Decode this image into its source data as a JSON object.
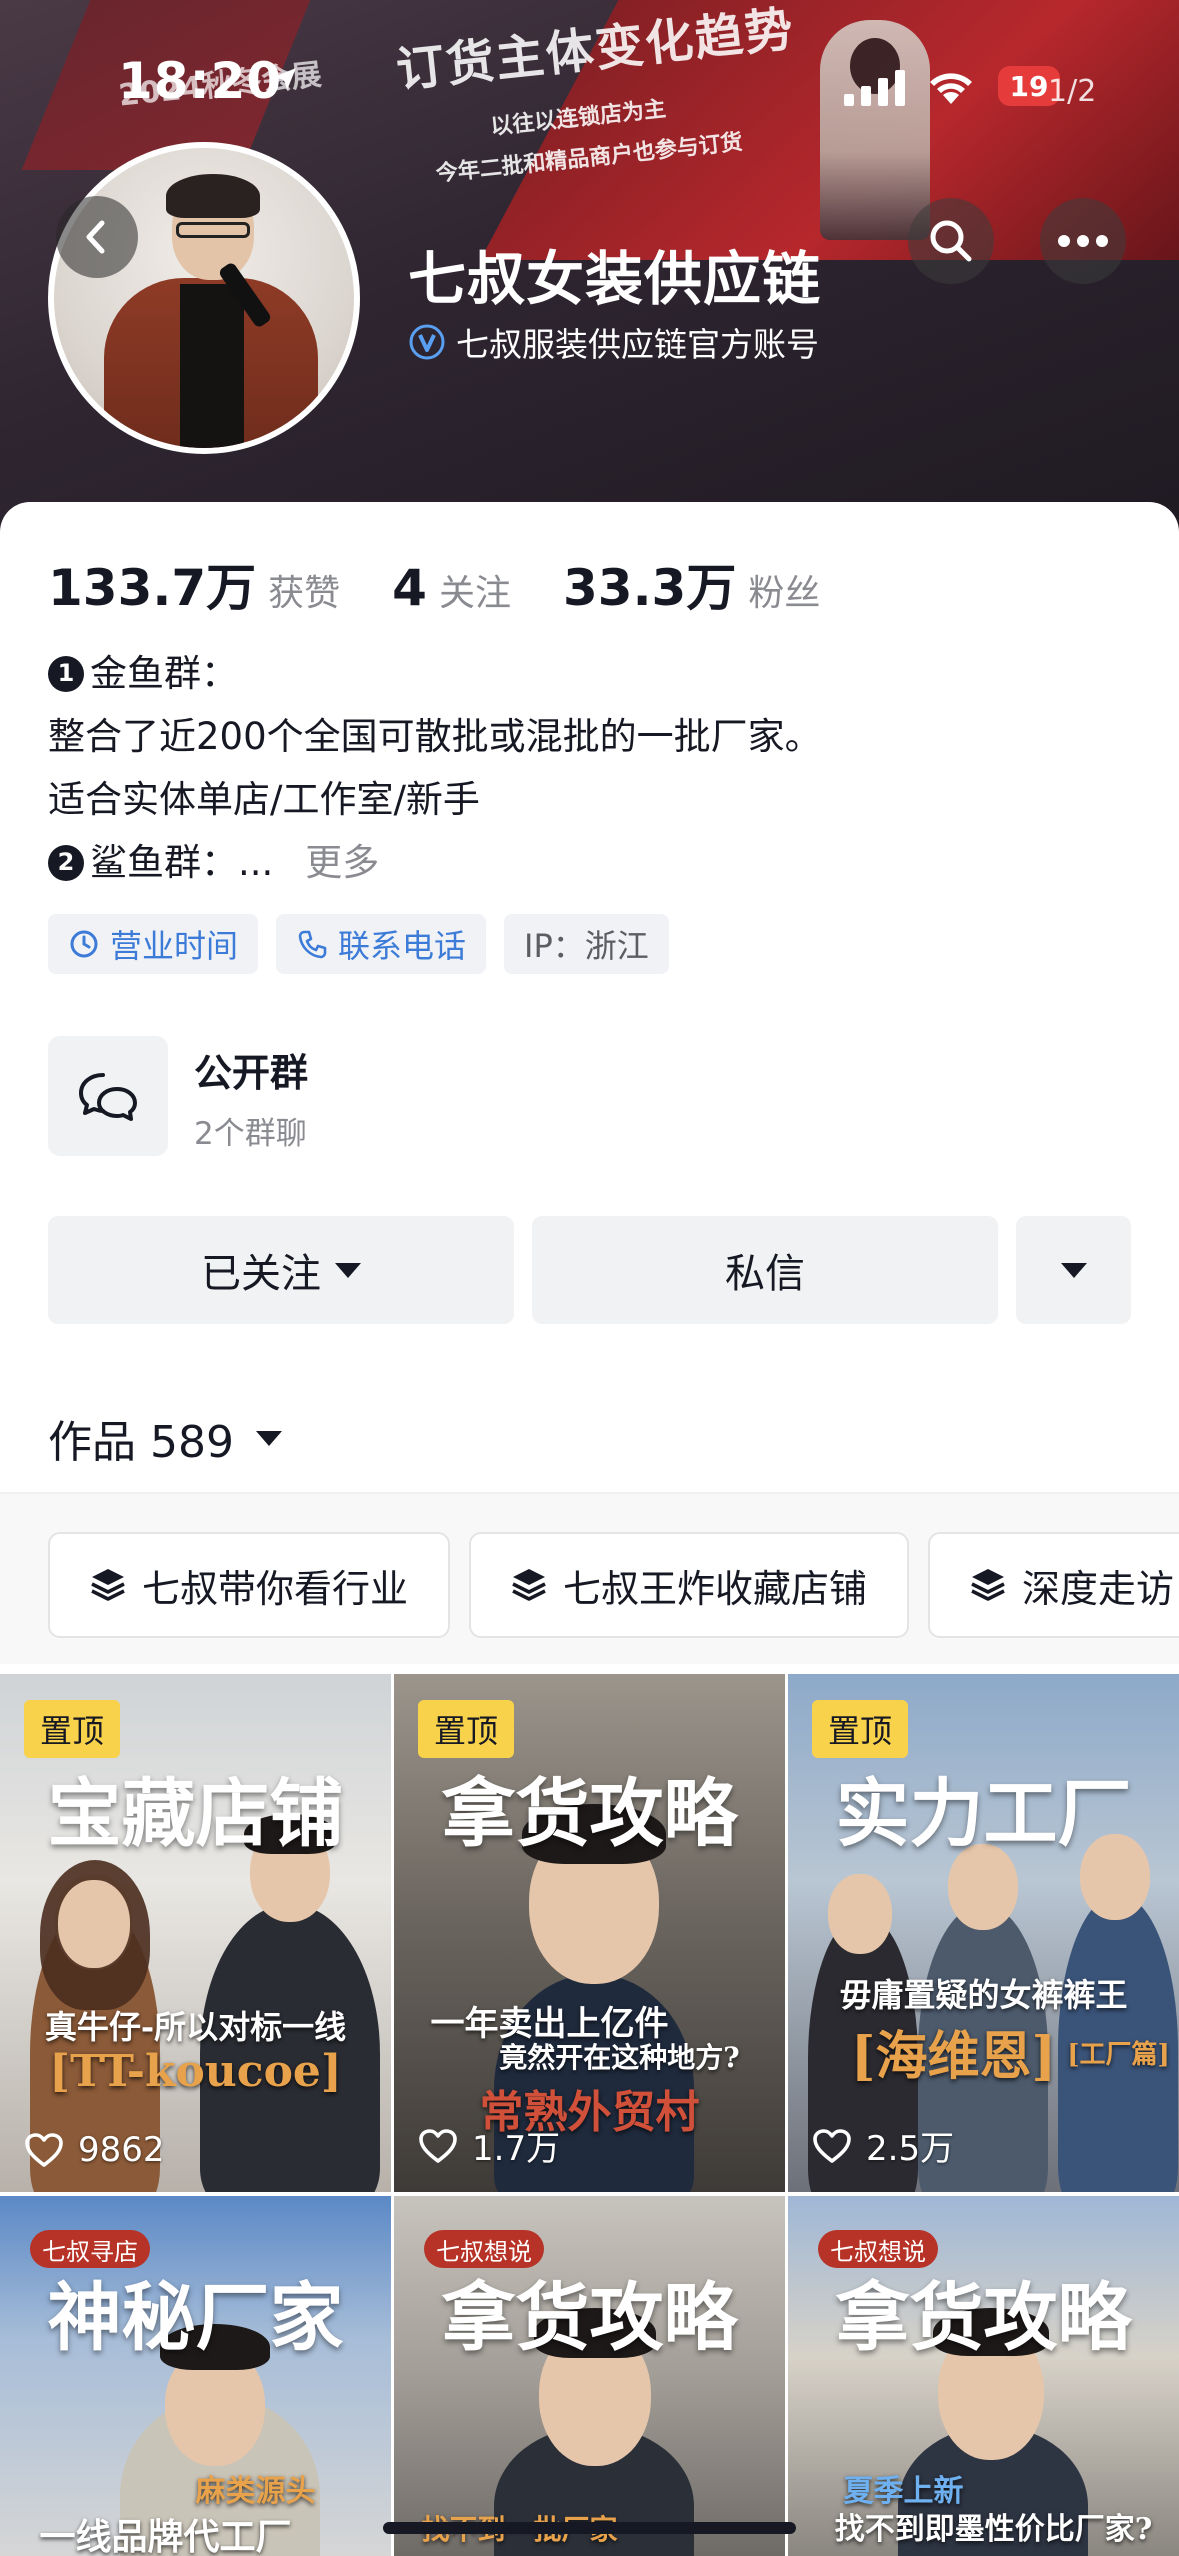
{
  "status_bar": {
    "time": "18:20",
    "battery": "19",
    "page_indicator": "1/2"
  },
  "banner": {
    "headline": "订货主体变化趋势",
    "sub1": "以往以连锁店为主",
    "sub2": "今年二批和精品商户也参与订货",
    "stage_text": "2024秋冬会展"
  },
  "profile": {
    "display_name": "七叔女装供应链",
    "verified_text": "七叔服装供应链官方账号"
  },
  "stats": [
    {
      "value": "133.7万",
      "label": "获赞"
    },
    {
      "value": "4",
      "label": "关注"
    },
    {
      "value": "33.3万",
      "label": "粉丝"
    }
  ],
  "bio": {
    "line1_num": "1",
    "line1": "金鱼群：",
    "line2": "整合了近200个全国可散批或混批的一批厂家。",
    "line3": "适合实体单店/工作室/新手",
    "line4_num": "2",
    "line4": "鲨鱼群：...",
    "more": "更多"
  },
  "tags": {
    "hours": "营业时间",
    "phone": "联系电话",
    "ip": "IP：浙江"
  },
  "group": {
    "title": "公开群",
    "subtitle": "2个群聊"
  },
  "actions": {
    "follow": "已关注",
    "message": "私信"
  },
  "works": {
    "label": "作品 589"
  },
  "collections": [
    "七叔带你看行业",
    "七叔王炸收藏店铺",
    "深度走访"
  ],
  "videos": [
    {
      "pin": "置顶",
      "title": "宝藏店铺",
      "caption1": "真牛仔-所以对标一线",
      "caption2": "[TT-koucoe]",
      "likes": "9862"
    },
    {
      "pin": "置顶",
      "title": "拿货攻略",
      "caption1": "一年卖出上亿件",
      "caption1b": "竟然开在这种地方?",
      "caption2": "常熟外贸村",
      "likes": "1.7万"
    },
    {
      "pin": "置顶",
      "title": "实力工厂",
      "caption1": "毋庸置疑的女裤裤王",
      "caption2": "[海维恩]",
      "caption2b": "[工厂篇]",
      "likes": "2.5万"
    },
    {
      "tag": "七叔寻店",
      "title": "神秘厂家",
      "caption1": "麻类源头",
      "caption2": "一线品牌代工厂"
    },
    {
      "tag": "七叔想说",
      "title": "拿货攻略",
      "caption1": "找不到一批厂家"
    },
    {
      "tag": "七叔想说",
      "title": "拿货攻略",
      "caption1": "夏季上新",
      "caption2": "找不到即墨性价比厂家?"
    }
  ],
  "colors": {
    "accent_blue": "#3d7bd8",
    "pin_yellow": "#f8d24a",
    "battery_red": "#e63b3b",
    "brand_red": "#b73227"
  }
}
